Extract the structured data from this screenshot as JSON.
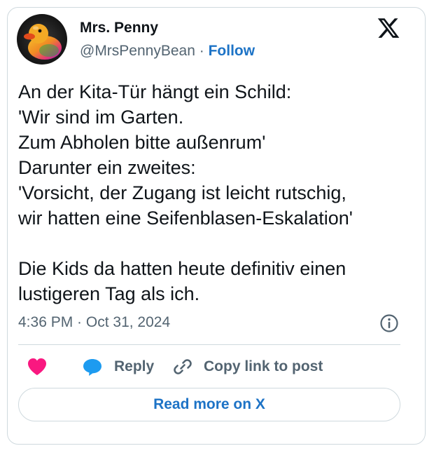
{
  "author": {
    "display_name": "Mrs. Penny",
    "handle": "@MrsPennyBean",
    "separator": " · ",
    "follow_label": "Follow",
    "avatar_icon": "rubber-duck-avatar"
  },
  "brand": {
    "logo_icon": "x-logo-icon"
  },
  "tweet": {
    "lines": [
      "An der Kita-Tür hängt ein Schild:",
      "'Wir sind im Garten.",
      "Zum Abholen bitte außenrum'",
      "Darunter ein zweites:",
      "'Vorsicht, der Zugang ist leicht rutschig,",
      "wir hatten eine Seifenblasen-Eskalation'",
      "",
      "Die Kids da hatten heute definitiv einen",
      "lustigeren Tag als ich."
    ],
    "time": "4:36 PM",
    "date_separator": " · ",
    "date": "Oct 31, 2024"
  },
  "actions": {
    "like_icon": "heart-icon",
    "reply_label": "Reply",
    "reply_icon": "speech-bubble-icon",
    "copy_label": "Copy link to post",
    "copy_icon": "link-icon"
  },
  "footer": {
    "read_more_label": "Read more on X"
  },
  "colors": {
    "link_blue": "#1d73c6",
    "heart_pink": "#f91880",
    "reply_blue": "#1d9bf0",
    "muted_gray": "#536471",
    "border": "#cfd9de"
  }
}
